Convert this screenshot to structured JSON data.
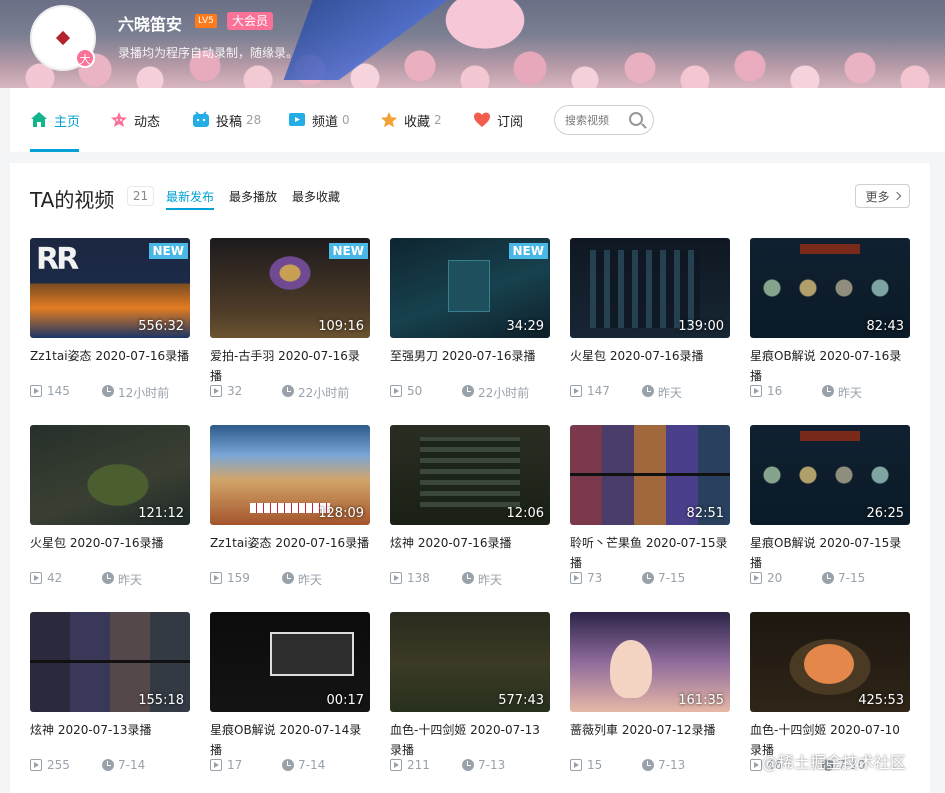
{
  "profile": {
    "name": "六晓笛安",
    "level": "LV5",
    "vip": "大会员",
    "sign": "录播均为程序自动录制，随缘录。",
    "avatar_badge": "大"
  },
  "nav": {
    "tabs": [
      {
        "label": "主页",
        "count": "",
        "icon": "home-icon"
      },
      {
        "label": "动态",
        "count": "",
        "icon": "dynamic-icon"
      },
      {
        "label": "投稿",
        "count": "28",
        "icon": "upload-icon"
      },
      {
        "label": "频道",
        "count": "0",
        "icon": "channel-icon"
      },
      {
        "label": "收藏",
        "count": "2",
        "icon": "star-icon"
      },
      {
        "label": "订阅",
        "count": "",
        "icon": "heart-icon"
      }
    ],
    "active_tab": "主页",
    "search_placeholder": "搜索视频"
  },
  "videos_section": {
    "title": "TA的视频",
    "count": "21",
    "sorts": [
      "最新发布",
      "最多播放",
      "最多收藏"
    ],
    "active_sort": "最新发布",
    "more_label": "更多"
  },
  "videos": [
    {
      "title": "Zz1tai姿态 2020-07-16录播",
      "duration": "556:32",
      "new": "NEW",
      "plays": "145",
      "time": "12小时前"
    },
    {
      "title": "爱拍-古手羽 2020-07-16录播",
      "duration": "109:16",
      "new": "NEW",
      "plays": "32",
      "time": "22小时前"
    },
    {
      "title": "至强男刀 2020-07-16录播",
      "duration": "34:29",
      "new": "NEW",
      "plays": "50",
      "time": "22小时前"
    },
    {
      "title": "火星包 2020-07-16录播",
      "duration": "139:00",
      "new": "",
      "plays": "147",
      "time": "昨天"
    },
    {
      "title": "星痕OB解说 2020-07-16录播",
      "duration": "82:43",
      "new": "",
      "plays": "16",
      "time": "昨天"
    },
    {
      "title": "火星包 2020-07-16录播",
      "duration": "121:12",
      "new": "",
      "plays": "42",
      "time": "昨天"
    },
    {
      "title": "Zz1tai姿态 2020-07-16录播",
      "duration": "128:09",
      "new": "",
      "plays": "159",
      "time": "昨天"
    },
    {
      "title": "炫神 2020-07-16录播",
      "duration": "12:06",
      "new": "",
      "plays": "138",
      "time": "昨天"
    },
    {
      "title": "聆听丶芒果鱼 2020-07-15录播",
      "duration": "82:51",
      "new": "",
      "plays": "73",
      "time": "7-15"
    },
    {
      "title": "星痕OB解说 2020-07-15录播",
      "duration": "26:25",
      "new": "",
      "plays": "20",
      "time": "7-15"
    },
    {
      "title": "炫神 2020-07-13录播",
      "duration": "155:18",
      "new": "",
      "plays": "255",
      "time": "7-14"
    },
    {
      "title": "星痕OB解说 2020-07-14录播",
      "duration": "00:17",
      "new": "",
      "plays": "17",
      "time": "7-14"
    },
    {
      "title": "血色-十四剑姬 2020-07-13录播",
      "duration": "577:43",
      "new": "",
      "plays": "211",
      "time": "7-13"
    },
    {
      "title": "蔷薇列車 2020-07-12录播",
      "duration": "161:35",
      "new": "",
      "plays": "15",
      "time": "7-13"
    },
    {
      "title": "血色-十四剑姬 2020-07-10录播",
      "duration": "425:53",
      "new": "",
      "plays": "46",
      "time": "7-10"
    }
  ],
  "watermark": "@稀土掘金技术社区",
  "colors": {
    "accent": "#00a1d6",
    "pink": "#fb7299",
    "meta": "#99a2aa"
  }
}
